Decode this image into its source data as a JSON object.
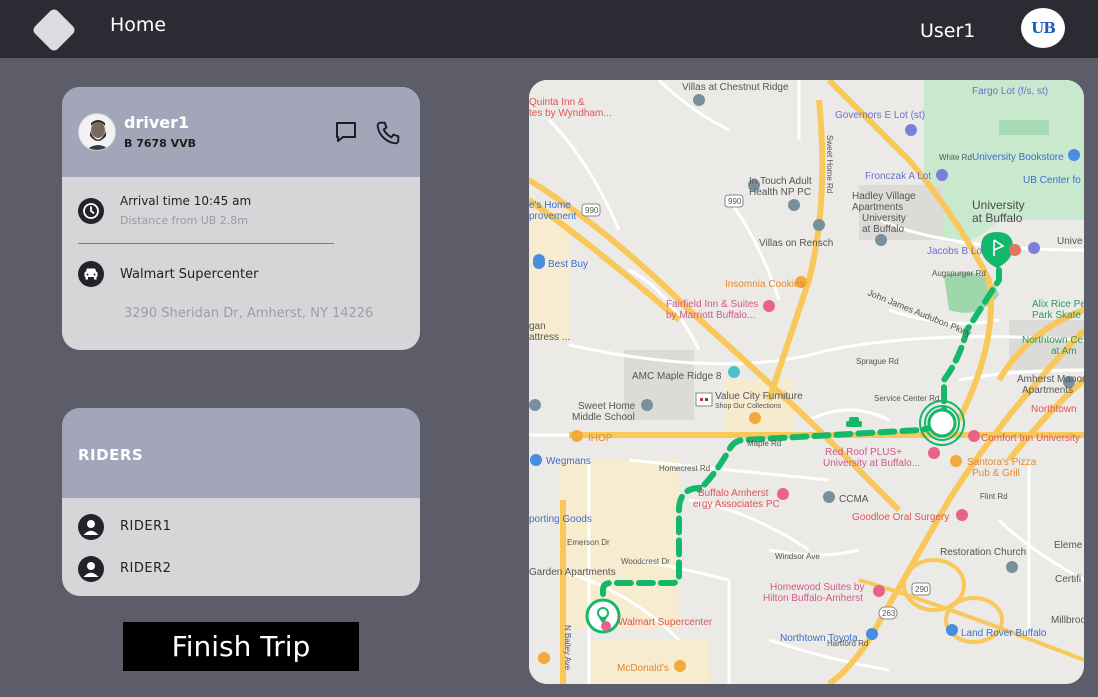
{
  "header": {
    "home_label": "Home",
    "username": "User1",
    "badge_text": "UB"
  },
  "driver": {
    "name": "driver1",
    "plate": "B 7678 VVB",
    "arrival": "Arrival time 10:45 am",
    "distance": "Distance from UB 2.8m",
    "destination_name": "Walmart Supercenter",
    "destination_address": "3290 Sheridan Dr, Amherst, NY 14226"
  },
  "riders": {
    "title": "RIDERS",
    "list": [
      {
        "name": "RIDER1"
      },
      {
        "name": "RIDER2"
      }
    ]
  },
  "actions": {
    "finish_label": "Finish Trip"
  },
  "map": {
    "labels": {
      "villas_chestnut": "Villas at Chestnut Ridge",
      "quinta_1": "Quinta Inn &",
      "quinta_2": "tes by Wyndham...",
      "governors": "Governors E Lot (st)",
      "fargo": "Fargo Lot (f/s, st)",
      "white_rd": "White Rd",
      "bookstore": "University Bookstore",
      "fronczak": "Fronczak A Lot",
      "ub_center": "UB Center fo",
      "in_touch_1": "In Touch Adult",
      "in_touch_2": "Health NP PC",
      "hadley_1": "Hadley Village",
      "hadley_2": "Apartments",
      "hadley_3": "University",
      "hadley_4": "at Buffalo",
      "univ_1": "University",
      "univ_2": "at Buffalo",
      "home_imp_1": "e's Home",
      "home_imp_2": "provement",
      "villas_rensch": "Villas on Rensch",
      "jacobs": "Jacobs B Lot",
      "univ_right": "Unive",
      "augspurger": "Augspurger Rd",
      "best_buy": "Best Buy",
      "insomnia": "Insomnia Cookies",
      "fairfield_1": "Fairfield Inn & Suites",
      "fairfield_2": "by Marriott Buffalo...",
      "alix_1": "Alix Rice Pe",
      "alix_2": "Park Skate",
      "audubon": "John James Audubon Pkwy",
      "gan_1": "gan",
      "gan_2": "attress ...",
      "northtown_center_1": "Northtown Ce",
      "northtown_center_2": "at Am",
      "sprague": "Sprague Rd",
      "amc": "AMC Maple Ridge 8",
      "amherst_manor_1": "Amherst Manor",
      "amherst_manor_2": "Apartments",
      "value_city_1": "Value City Furniture",
      "value_city_2": "Shop Our Collections",
      "service_center": "Service Center Rd",
      "sweet_home_ms_1": "Sweet Home",
      "sweet_home_ms_2": "Middle School",
      "northtown_right": "Northtown",
      "ihop": "IHOP",
      "maple_rd": "Maple Rd",
      "comfort_inn": "Comfort Inn University",
      "red_roof_1": "Red Roof PLUS+",
      "red_roof_2": "University at Buffalo...",
      "santoras_1": "Santora's Pizza",
      "santoras_2": "Pub & Grill",
      "wegmans": "Wegmans",
      "homecrest": "Homecrest Rd",
      "buffalo_amherst_1": "Buffalo Amherst",
      "buffalo_amherst_2": "ergy Associates PC",
      "ccma": "CCMA",
      "flint_rd": "Flint Rd",
      "sporting": "porting Goods",
      "goodloe": "Goodloe Oral Surgery",
      "emerson": "Emerson Dr",
      "restoration": "Restoration Church",
      "eleme": "Eleme",
      "windsor": "Windsor Ave",
      "woodcrest": "Woodcrest Dr",
      "garden_apts": "Garden Apartments",
      "certifi": "Certifi",
      "homewood_1": "Homewood Suites by",
      "homewood_2": "Hilton Buffalo-Amherst",
      "walmart": "Walmart Supercenter",
      "land_rover": "Land Rover Buffalo",
      "northtown_toyota": "Northtown Toyota",
      "millbrook": "Millbrook",
      "mcdonalds": "McDonald's",
      "hartford": "Hartford Rd",
      "n_bailey": "N Bailey Ave",
      "sweet_home_rd": "Sweet Home Rd",
      "hwy_990": "990",
      "hwy_290": "290",
      "hwy_263": "263"
    }
  },
  "colors": {
    "route": "#14b86a",
    "header_bg": "#2b2c33",
    "page_bg": "#5c5d69",
    "card_header": "#a2a6b8",
    "card_body": "#d6d6d9"
  }
}
